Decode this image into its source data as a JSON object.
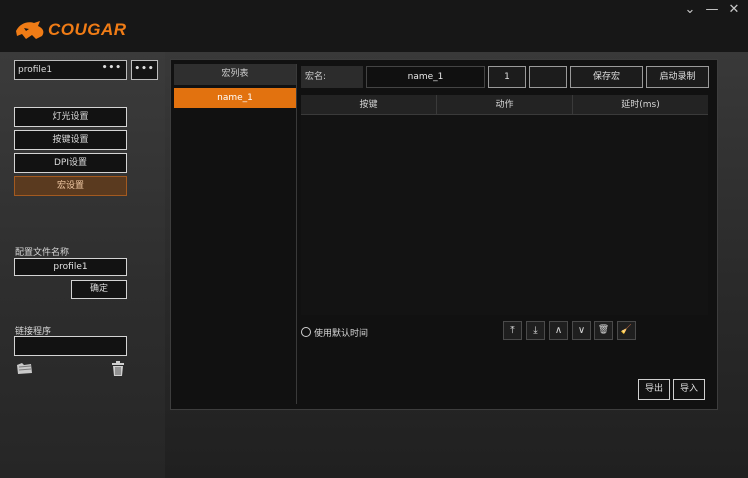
{
  "app": {
    "logo_text": "COUGAR",
    "accent_color": "#f07c16",
    "window_controls": [
      "chevron-down-icon",
      "minimize-icon",
      "close-icon"
    ]
  },
  "sidebar": {
    "profile_select_value": "profile1",
    "profile_select_dots": "•••",
    "more_button": "•••",
    "nav": [
      {
        "label": "灯光设置",
        "active": false
      },
      {
        "label": "按键设置",
        "active": false
      },
      {
        "label": "DPI设置",
        "active": false
      },
      {
        "label": "宏设置",
        "active": true
      }
    ],
    "profile_name_label": "配置文件名称",
    "profile_name_value": "profile1",
    "confirm_button": "确定",
    "shortcut_label": "链接程序",
    "shortcut_value": ""
  },
  "macro": {
    "list_header": "宏列表",
    "list_items": [
      "name_1"
    ],
    "name_label": "宏名:",
    "name_value": "name_1",
    "count_value": "1",
    "blank_button": "",
    "save_button": "保存宏",
    "record_button": "启动录制",
    "columns": [
      "按键",
      "动作",
      "延时(ms)"
    ],
    "default_time_label": "使用默认时间",
    "tools": [
      "move-top-icon",
      "move-bottom-icon",
      "move-up-icon",
      "move-down-icon",
      "delete-icon",
      "clear-icon"
    ],
    "tool_glyphs": [
      "⤒",
      "⤓",
      "∧",
      "∨",
      "🗑",
      "🧹"
    ],
    "export_button": "导出",
    "import_button": "导入"
  }
}
